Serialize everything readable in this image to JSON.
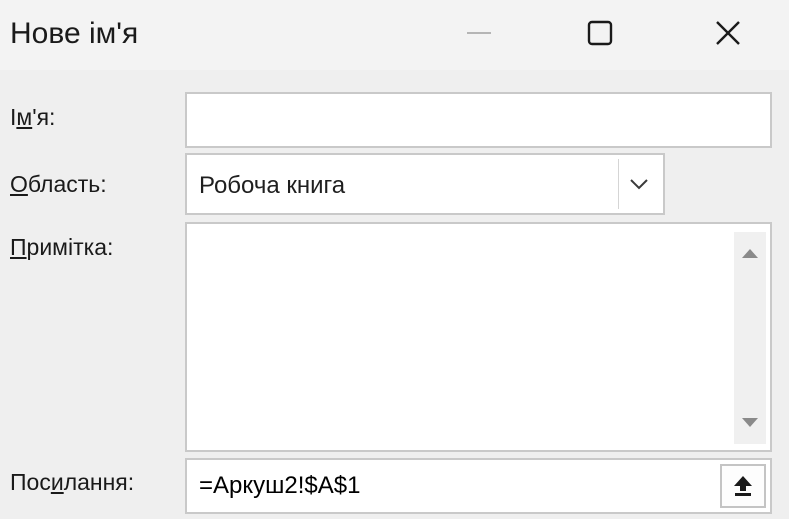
{
  "window": {
    "title": "Нове ім'я",
    "controls": {
      "minimize_icon": "minimize-icon",
      "maximize_icon": "maximize-icon",
      "close_icon": "close-icon"
    }
  },
  "form": {
    "name": {
      "label_mnemonic": "І",
      "label_underlined": "м",
      "label_rest": "'я:",
      "value": ""
    },
    "scope": {
      "label_underlined": "О",
      "label_rest": "бласть:",
      "selected": "Робоча книга",
      "arrow_icon": "chevron-down-icon"
    },
    "comment": {
      "label_underlined": "П",
      "label_rest": "римітка:",
      "value": "",
      "scroll_up_icon": "scroll-up-arrow-icon",
      "scroll_down_icon": "scroll-down-arrow-icon"
    },
    "refers_to": {
      "label_pre": "Пос",
      "label_underlined": "и",
      "label_rest": "лання:",
      "value": "=Аркуш2!$A$1",
      "collapse_icon": "collapse-dialog-icon"
    }
  },
  "colors": {
    "background": "#efefef",
    "field_border": "#c9c9c9",
    "text": "#1a1a1a"
  }
}
